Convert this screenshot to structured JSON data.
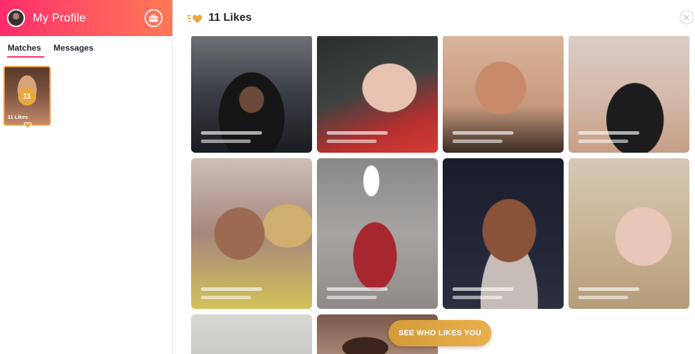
{
  "sidebar": {
    "profile_title": "My Profile",
    "tabs": [
      {
        "label": "Matches",
        "active": true
      },
      {
        "label": "Messages",
        "active": false
      }
    ],
    "likes_card": {
      "count": "11",
      "label": "11 Likes"
    }
  },
  "main": {
    "title": "11 Likes",
    "cta_label": "SEE WHO LIKES YOU"
  },
  "colors": {
    "brand_gradient_start": "#fd2b6c",
    "brand_gradient_end": "#ff7854",
    "gold": "#e8a93e"
  },
  "icons": [
    "briefcase-icon",
    "likes-hearts-icon",
    "close-icon",
    "heart-icon"
  ]
}
